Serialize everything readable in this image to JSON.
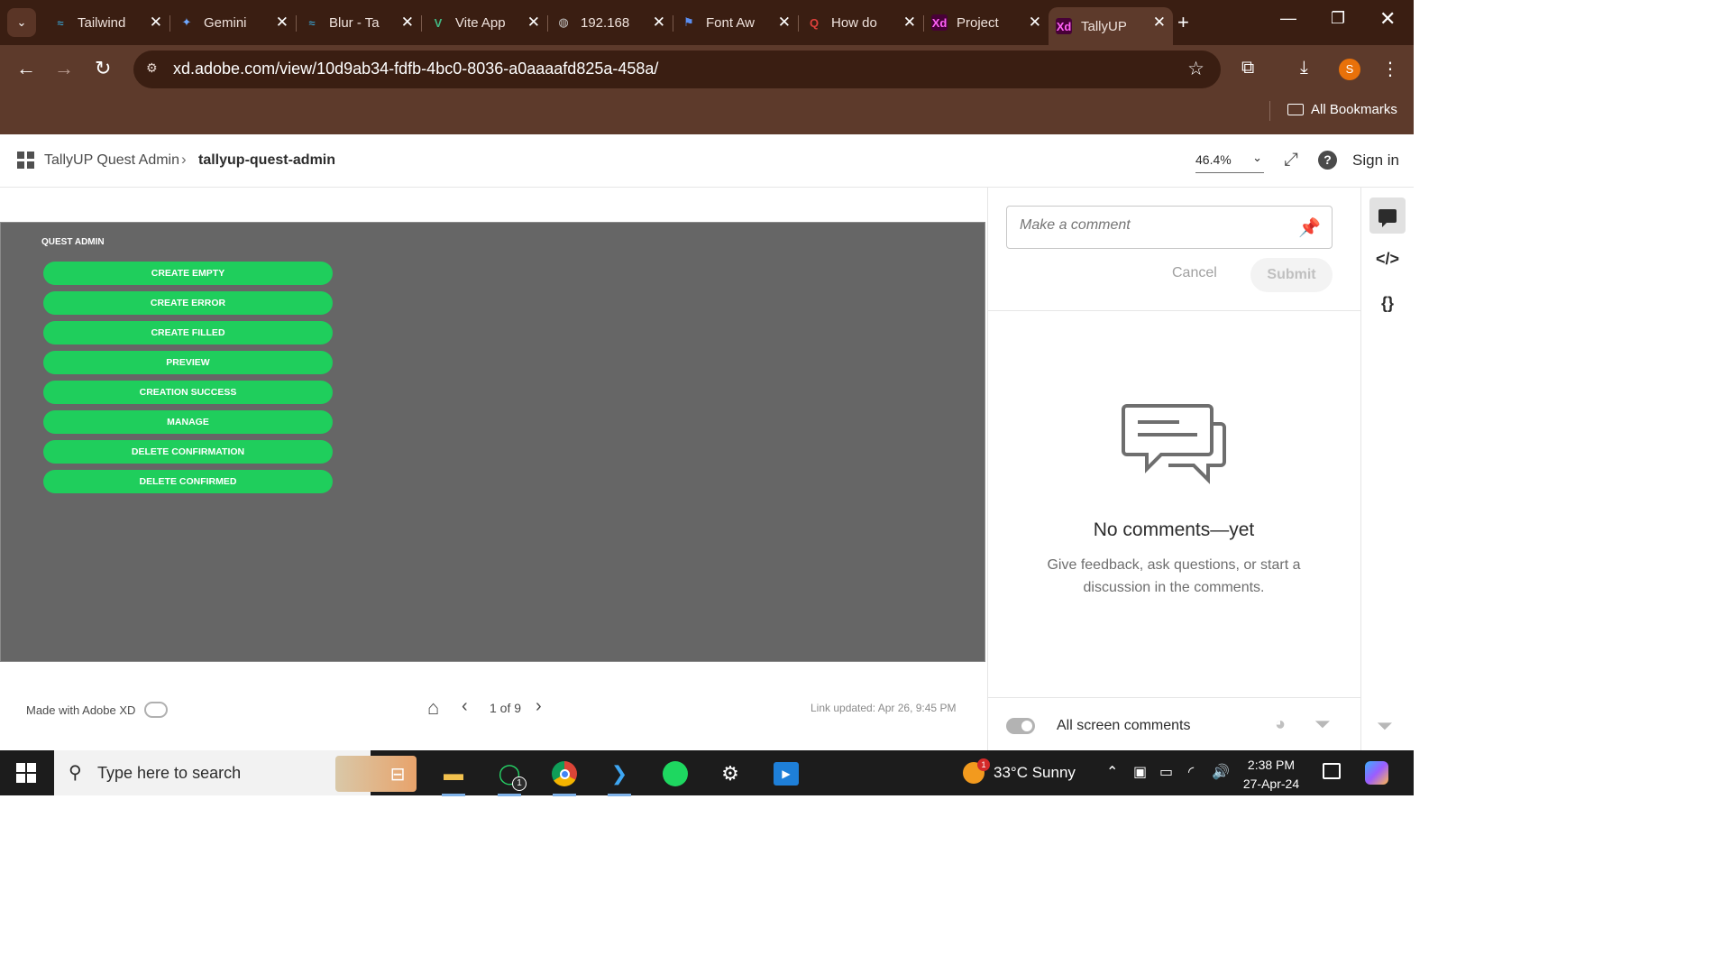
{
  "browser": {
    "tabs": [
      {
        "title": "Tailwind",
        "icon": "tailwind-icon",
        "active": false
      },
      {
        "title": "Gemini",
        "icon": "gemini-icon",
        "active": false
      },
      {
        "title": "Blur - Ta",
        "icon": "tailwind-icon",
        "active": false
      },
      {
        "title": "Vite App",
        "icon": "vue-icon",
        "active": false
      },
      {
        "title": "192.168",
        "icon": "globe-icon",
        "active": false
      },
      {
        "title": "Font Aw",
        "icon": "flag-icon",
        "active": false
      },
      {
        "title": "How do",
        "icon": "quora-icon",
        "active": false
      },
      {
        "title": "Project",
        "icon": "xd-icon",
        "active": false
      },
      {
        "title": "TallyUP",
        "icon": "xd-icon",
        "active": true
      }
    ],
    "url": "xd.adobe.com/view/10d9ab34-fdfb-4bc0-8036-a0aaaafd825a-458a/",
    "profile_initial": "S",
    "bookmarks_label": "All Bookmarks",
    "colors": {
      "frame": "#3a1e12",
      "toolbar": "#5d3a2b"
    }
  },
  "xd": {
    "breadcrumb": {
      "project": "TallyUP Quest Admin",
      "document": "tallyup-quest-admin"
    },
    "zoom": "46.4%",
    "sign_in": "Sign in",
    "artboard": {
      "title": "QUEST ADMIN",
      "buttons": [
        "CREATE EMPTY",
        "CREATE ERROR",
        "CREATE FILLED",
        "PREVIEW",
        "CREATION SUCCESS",
        "MANAGE",
        "DELETE CONFIRMATION",
        "DELETE CONFIRMED"
      ],
      "button_color": "#1fce5c",
      "background_color": "#666666"
    },
    "footer": {
      "made_with": "Made with Adobe XD",
      "pager": "1 of 9",
      "link_updated": "Link updated: Apr 26, 9:45 PM"
    },
    "comments": {
      "placeholder": "Make a comment",
      "cancel": "Cancel",
      "submit": "Submit",
      "empty_title": "No comments—yet",
      "empty_desc": "Give feedback, ask questions, or start a discussion in the comments.",
      "filter_label": "All screen comments"
    }
  },
  "taskbar": {
    "search_placeholder": "Type here to search",
    "whatsapp_badge": "1",
    "weather": "33°C  Sunny",
    "weather_badge": "1",
    "time": "2:38 PM",
    "date": "27-Apr-24"
  }
}
